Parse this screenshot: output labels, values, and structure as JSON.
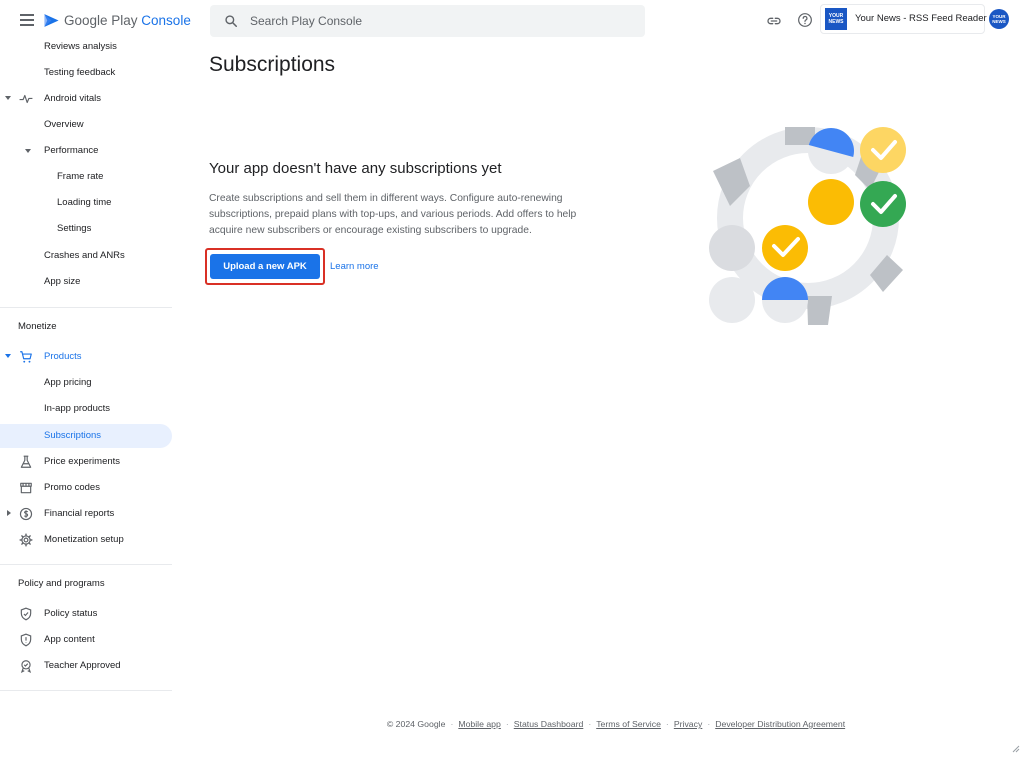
{
  "header": {
    "brand_prefix": "Google Play ",
    "brand_accent": "Console",
    "search_placeholder": "Search Play Console",
    "app_name": "Your News - RSS Feed Reader",
    "app_icon_text": "YOUR NEWS",
    "avatar_text": "YOUR NEWS"
  },
  "sidebar": {
    "items": [
      {
        "label": "Reviews analysis"
      },
      {
        "label": "Testing feedback"
      },
      {
        "label": "Android vitals"
      },
      {
        "label": "Overview"
      },
      {
        "label": "Performance"
      },
      {
        "label": "Frame rate"
      },
      {
        "label": "Loading time"
      },
      {
        "label": "Settings"
      },
      {
        "label": "Crashes and ANRs"
      },
      {
        "label": "App size"
      }
    ],
    "monetize_title": "Monetize",
    "monetize_items": [
      {
        "label": "Products"
      },
      {
        "label": "App pricing"
      },
      {
        "label": "In-app products"
      },
      {
        "label": "Subscriptions"
      },
      {
        "label": "Price experiments"
      },
      {
        "label": "Promo codes"
      },
      {
        "label": "Financial reports"
      },
      {
        "label": "Monetization setup"
      }
    ],
    "policy_title": "Policy and programs",
    "policy_items": [
      {
        "label": "Policy status"
      },
      {
        "label": "App content"
      },
      {
        "label": "Teacher Approved"
      }
    ]
  },
  "main": {
    "page_title": "Subscriptions",
    "empty_title": "Your app doesn't have any subscriptions yet",
    "empty_desc": "Create subscriptions and sell them in different ways. Configure auto-renewing subscriptions, prepaid plans with top-ups, and various periods. Add offers to help acquire new subscribers or encourage existing subscribers to upgrade.",
    "primary_button": "Upload a new APK",
    "learn_more": "Learn more"
  },
  "footer": {
    "copyright": "© 2024 Google",
    "links": [
      "Mobile app",
      "Status Dashboard",
      "Terms of Service",
      "Privacy",
      "Developer Distribution Agreement"
    ]
  },
  "colors": {
    "accent": "#1a73e8",
    "active_bg": "#e8f0fe",
    "highlight": "#d93025",
    "yellow": "#fbbc04",
    "green": "#34a853"
  }
}
